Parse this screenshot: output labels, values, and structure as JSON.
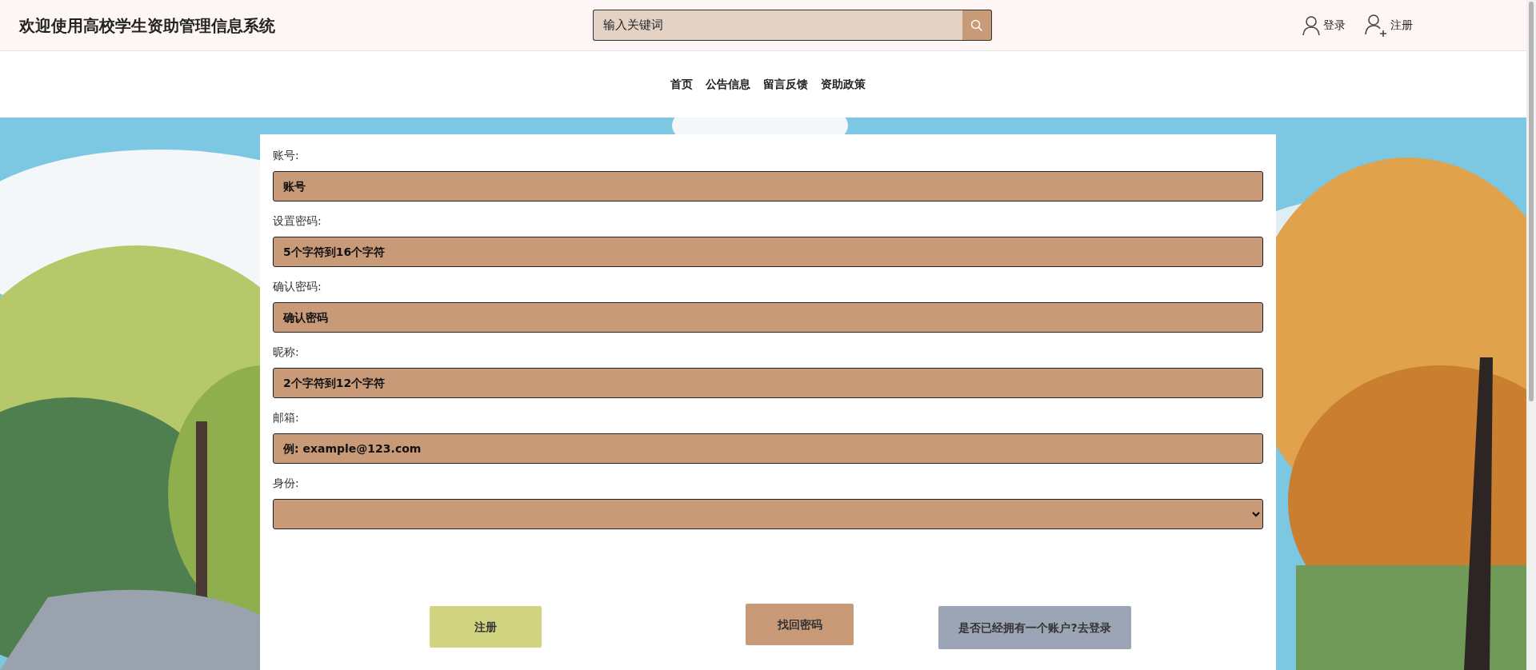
{
  "header": {
    "title": "欢迎使用高校学生资助管理信息系统",
    "search": {
      "placeholder": "输入关键词"
    },
    "links": [
      {
        "kind": "login",
        "label": "登录"
      },
      {
        "kind": "register",
        "label": "注册"
      }
    ]
  },
  "nav": [
    {
      "label": "首页"
    },
    {
      "label": "公告信息"
    },
    {
      "label": "留言反馈"
    },
    {
      "label": "资助政策"
    }
  ],
  "form": {
    "fields": [
      {
        "label": "账号:",
        "kind": "input",
        "placeholder": "账号"
      },
      {
        "label": "设置密码:",
        "kind": "input",
        "placeholder": "5个字符到16个字符"
      },
      {
        "label": "确认密码:",
        "kind": "input",
        "placeholder": "确认密码"
      },
      {
        "label": "昵称:",
        "kind": "input",
        "placeholder": "2个字符到12个字符"
      },
      {
        "label": "邮箱:",
        "kind": "input",
        "placeholder": "例: example@123.com"
      },
      {
        "label": "身份:",
        "kind": "select"
      }
    ],
    "buttons": [
      {
        "kind": "register",
        "label": "注册"
      },
      {
        "kind": "recover",
        "label": "找回密码"
      },
      {
        "kind": "login",
        "label": "是否已经拥有一个账户?去登录"
      }
    ]
  }
}
